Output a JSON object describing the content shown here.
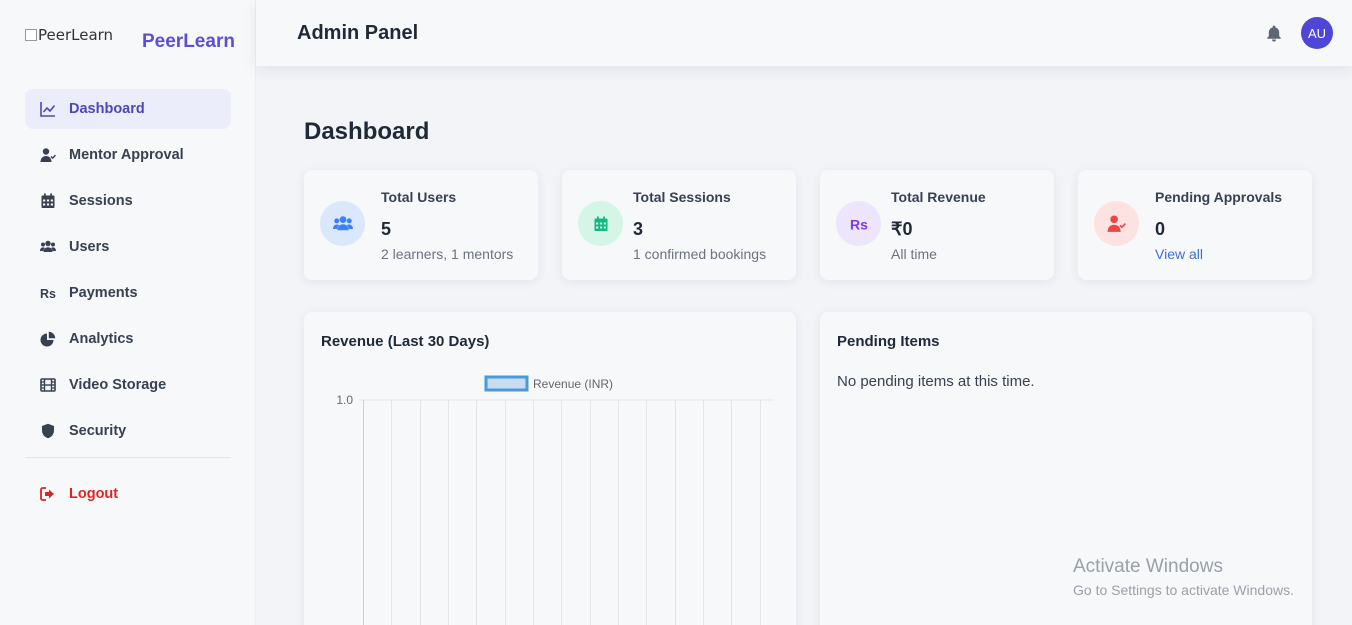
{
  "brand": {
    "logo_alt": "PeerLearn",
    "name": "PeerLearn"
  },
  "sidebar": {
    "items": [
      {
        "label": "Dashboard",
        "icon": "chart-line-icon",
        "active": true
      },
      {
        "label": "Mentor Approval",
        "icon": "user-check-icon"
      },
      {
        "label": "Sessions",
        "icon": "calendar-icon"
      },
      {
        "label": "Users",
        "icon": "users-icon"
      },
      {
        "label": "Payments",
        "icon": "rupee-icon"
      },
      {
        "label": "Analytics",
        "icon": "pie-chart-icon"
      },
      {
        "label": "Video Storage",
        "icon": "film-icon"
      },
      {
        "label": "Security",
        "icon": "shield-icon"
      }
    ],
    "logout": {
      "label": "Logout",
      "icon": "sign-out-icon"
    }
  },
  "header": {
    "title": "Admin Panel",
    "avatar_initials": "AU"
  },
  "main": {
    "title": "Dashboard",
    "stats": [
      {
        "label": "Total Users",
        "value": "5",
        "sub": "2 learners, 1 mentors",
        "icon": "users-icon",
        "color": "#3b82f6",
        "bg": "#dbe7fb"
      },
      {
        "label": "Total Sessions",
        "value": "3",
        "sub": "1 confirmed bookings",
        "icon": "calendar-icon",
        "color": "#10b981",
        "bg": "#d5f5e6"
      },
      {
        "label": "Total Revenue",
        "value": "₹0",
        "sub": "All time",
        "icon": "rupee-icon",
        "color": "#7c3aed",
        "bg": "#ece5fb"
      },
      {
        "label": "Pending Approvals",
        "value": "0",
        "sub": "View all",
        "icon": "user-check-icon",
        "color": "#ef4444",
        "bg": "#fde2e2"
      }
    ],
    "revenue_panel": {
      "title": "Revenue (Last 30 Days)"
    },
    "pending_panel": {
      "title": "Pending Items",
      "empty_text": "No pending items at this time."
    }
  },
  "chart_data": {
    "type": "line",
    "title": "",
    "series": [
      {
        "name": "Revenue (INR)",
        "values": []
      }
    ],
    "ylabel": "",
    "ylim": [
      0,
      1.0
    ],
    "y_ticks": [
      "1.0"
    ],
    "grid": true,
    "legend": "top-center",
    "colors": {
      "series_stroke": "#4a9ad8",
      "series_fill": "#c8ddf1"
    }
  },
  "watermark": {
    "line1": "Activate Windows",
    "line2": "Go to Settings to activate Windows."
  }
}
